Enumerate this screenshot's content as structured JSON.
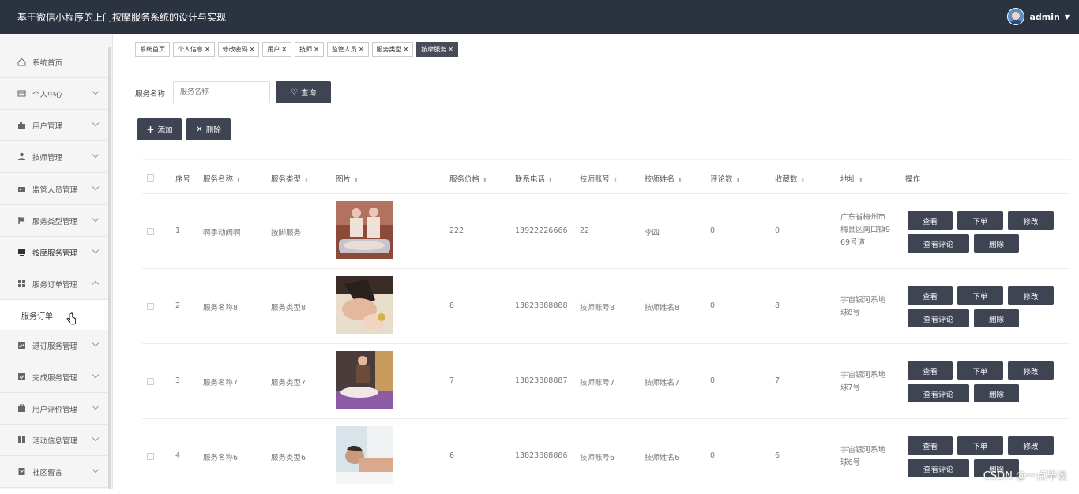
{
  "header": {
    "title": "基于微信小程序的上门按摩服务系统的设计与实现",
    "user": "admin"
  },
  "sidebar": {
    "items": [
      {
        "label": "系统首页",
        "icon": "home-icon"
      },
      {
        "label": "个人中心",
        "icon": "profile-icon"
      },
      {
        "label": "用户管理",
        "icon": "users-icon"
      },
      {
        "label": "技师管理",
        "icon": "technician-icon"
      },
      {
        "label": "监管人员管理",
        "icon": "supervisor-icon"
      },
      {
        "label": "服务类型管理",
        "icon": "flag-icon"
      },
      {
        "label": "按摩服务管理",
        "icon": "monitor-icon"
      },
      {
        "label": "服务订单管理",
        "icon": "grid-icon"
      },
      {
        "label": "退订服务管理",
        "icon": "chart-icon"
      },
      {
        "label": "完成服务管理",
        "icon": "check-icon"
      },
      {
        "label": "用户评价管理",
        "icon": "briefcase-icon"
      },
      {
        "label": "活动信息管理",
        "icon": "grid-icon"
      },
      {
        "label": "社区留言",
        "icon": "message-icon"
      }
    ],
    "submenu": "服务订单"
  },
  "tabs": [
    "系统首页",
    "个人信息",
    "修改密码",
    "用户",
    "技师",
    "监管人员",
    "服务类型",
    "按摩服务"
  ],
  "search": {
    "label": "服务名称",
    "placeholder": "服务名称",
    "button": "查询"
  },
  "actions": {
    "add": "添加",
    "delete": "删除"
  },
  "table": {
    "headers": [
      "序号",
      "服务名称",
      "服务类型",
      "图片",
      "服务价格",
      "联系电话",
      "技师账号",
      "技师姓名",
      "评论数",
      "收藏数",
      "地址",
      "操作"
    ],
    "rows": [
      {
        "no": "1",
        "name": "啊手动阀啊",
        "type": "按脚服务",
        "price": "222",
        "phone": "13922226666",
        "account": "22",
        "tech_name": "李四",
        "comments": "0",
        "favorites": "0",
        "address": "广东省梅州市梅县区南口镇969号道"
      },
      {
        "no": "2",
        "name": "服务名称8",
        "type": "服务类型8",
        "price": "8",
        "phone": "13823888888",
        "account": "技师账号8",
        "tech_name": "技师姓名8",
        "comments": "0",
        "favorites": "8",
        "address": "宇宙银河系地球8号"
      },
      {
        "no": "3",
        "name": "服务名称7",
        "type": "服务类型7",
        "price": "7",
        "phone": "13823888887",
        "account": "技师账号7",
        "tech_name": "技师姓名7",
        "comments": "0",
        "favorites": "7",
        "address": "宇宙银河系地球7号"
      },
      {
        "no": "4",
        "name": "服务名称6",
        "type": "服务类型6",
        "price": "6",
        "phone": "13823888886",
        "account": "技师账号6",
        "tech_name": "技师姓名6",
        "comments": "0",
        "favorites": "6",
        "address": "宇宙银河系地球6号"
      }
    ],
    "ops": {
      "view": "查看",
      "order": "下单",
      "edit": "修改",
      "comments": "查看评论",
      "delete": "删除"
    }
  },
  "watermark": "CSDN @一点毕设",
  "colors": {
    "topbar": "#2b3240",
    "button": "#3e4452",
    "active_tab": "#474c56"
  }
}
